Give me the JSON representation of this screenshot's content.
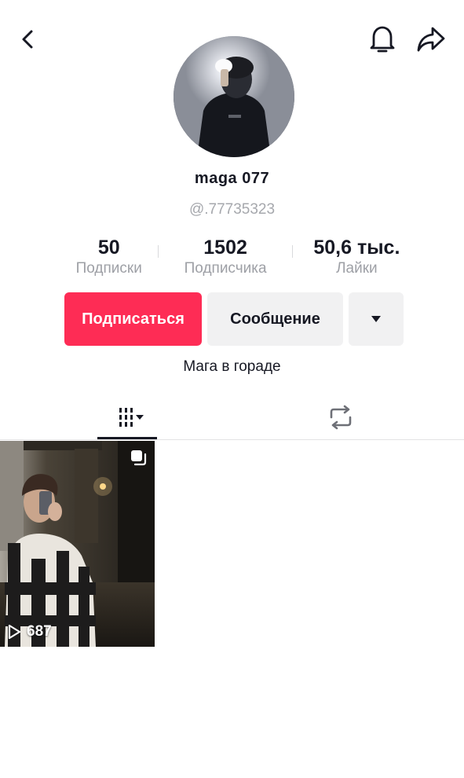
{
  "profile": {
    "nickname": "maga 077",
    "username": "@.77735323",
    "bio": "Мага в гораде"
  },
  "stats": [
    {
      "value": "50",
      "label": "Подписки"
    },
    {
      "value": "1502",
      "label": "Подписчика"
    },
    {
      "value": "50,6 тыс.",
      "label": "Лайки"
    }
  ],
  "actions": {
    "follow_label": "Подписаться",
    "message_label": "Сообщение",
    "more_icon": "triangle-down-icon"
  },
  "nav": {
    "back_icon": "chevron-left-icon",
    "bell_icon": "bell-icon",
    "share_icon": "share-arrow-icon"
  },
  "tabs": [
    {
      "name": "videos",
      "icon": "grid-icon",
      "active": true
    },
    {
      "name": "reposts",
      "icon": "repost-icon",
      "active": false
    }
  ],
  "videos": [
    {
      "views": "687",
      "pinned": true
    }
  ],
  "colors": {
    "accent": "#fe2c55",
    "secondary_button": "#f1f1f2",
    "muted_text": "#9ea0a6"
  }
}
